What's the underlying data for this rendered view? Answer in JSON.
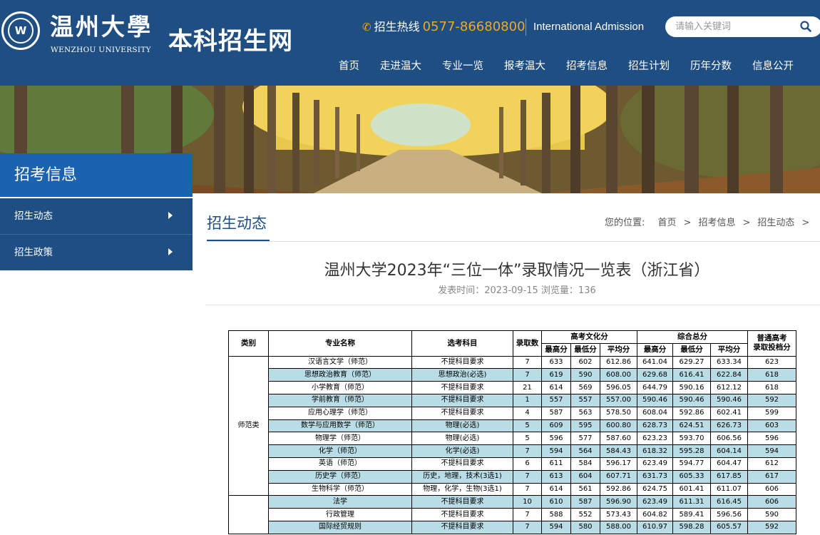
{
  "header": {
    "logo_mark": "W",
    "university_cn": "温州大學",
    "university_en": "WENZHOU UNIVERSITY",
    "site_title": "本科招生网",
    "hotline_label": "招生热线",
    "hotline_number": "0577-86680800",
    "intl_link": "International Admission",
    "search_placeholder": "请输入关键词",
    "nav": [
      "首页",
      "走进温大",
      "专业一览",
      "报考温大",
      "招考信息",
      "招生计划",
      "历年分数",
      "信息公开"
    ]
  },
  "sidebar": {
    "title": "招考信息",
    "items": [
      {
        "label": "招生动态"
      },
      {
        "label": "招生政策"
      }
    ]
  },
  "section": {
    "title": "招生动态",
    "breadcrumb_prefix": "您的位置:",
    "breadcrumb": [
      "首页",
      "招考信息",
      "招生动态"
    ],
    "sep": ">"
  },
  "article": {
    "title": "温州大学2023年“三位一体”录取情况一览表（浙江省）",
    "meta": "发表时间：2023-09-15   浏览量：136"
  },
  "table": {
    "headers": {
      "category": "类别",
      "major": "专业名称",
      "subject": "选考科目",
      "admitted": "录取数",
      "gaokao_group": "高考文化分",
      "composite_group": "综合总分",
      "max": "最高分",
      "min": "最低分",
      "avg": "平均分",
      "cutoff_line1": "普通高考",
      "cutoff_line2": "录取投档分"
    },
    "groups": [
      {
        "category": "师范类",
        "rows": [
          {
            "major": "汉语言文学（师范）",
            "subject": "不提科目要求",
            "count": "7",
            "g_max": "633",
            "g_min": "602",
            "g_avg": "612.86",
            "c_max": "641.04",
            "c_min": "629.27",
            "c_avg": "633.34",
            "cutoff": "623"
          },
          {
            "major": "思想政治教育（师范）",
            "subject": "思想政治(必选)",
            "count": "7",
            "g_max": "619",
            "g_min": "590",
            "g_avg": "608.00",
            "c_max": "629.68",
            "c_min": "616.41",
            "c_avg": "622.84",
            "cutoff": "618"
          },
          {
            "major": "小学教育（师范）",
            "subject": "不提科目要求",
            "count": "21",
            "g_max": "614",
            "g_min": "569",
            "g_avg": "596.05",
            "c_max": "644.79",
            "c_min": "590.16",
            "c_avg": "612.12",
            "cutoff": "618"
          },
          {
            "major": "学前教育（师范）",
            "subject": "不提科目要求",
            "count": "1",
            "g_max": "557",
            "g_min": "557",
            "g_avg": "557.00",
            "c_max": "590.46",
            "c_min": "590.46",
            "c_avg": "590.46",
            "cutoff": "592"
          },
          {
            "major": "应用心理学（师范）",
            "subject": "不提科目要求",
            "count": "4",
            "g_max": "587",
            "g_min": "563",
            "g_avg": "578.50",
            "c_max": "608.04",
            "c_min": "592.86",
            "c_avg": "602.41",
            "cutoff": "599"
          },
          {
            "major": "数学与应用数学（师范）",
            "subject": "物理(必选)",
            "count": "5",
            "g_max": "609",
            "g_min": "595",
            "g_avg": "600.80",
            "c_max": "628.73",
            "c_min": "624.51",
            "c_avg": "626.73",
            "cutoff": "603"
          },
          {
            "major": "物理学（师范）",
            "subject": "物理(必选)",
            "count": "5",
            "g_max": "596",
            "g_min": "577",
            "g_avg": "587.60",
            "c_max": "623.23",
            "c_min": "593.70",
            "c_avg": "606.56",
            "cutoff": "596"
          },
          {
            "major": "化学（师范）",
            "subject": "化学(必选)",
            "count": "7",
            "g_max": "594",
            "g_min": "564",
            "g_avg": "584.43",
            "c_max": "618.32",
            "c_min": "595.28",
            "c_avg": "604.14",
            "cutoff": "594"
          },
          {
            "major": "英语（师范）",
            "subject": "不提科目要求",
            "count": "6",
            "g_max": "611",
            "g_min": "584",
            "g_avg": "596.17",
            "c_max": "623.49",
            "c_min": "594.77",
            "c_avg": "604.47",
            "cutoff": "612"
          },
          {
            "major": "历史学（师范）",
            "subject": "历史，地理，技术(3选1)",
            "count": "7",
            "g_max": "613",
            "g_min": "604",
            "g_avg": "607.71",
            "c_max": "631.73",
            "c_min": "605.33",
            "c_avg": "617.85",
            "cutoff": "617"
          },
          {
            "major": "生物科学（师范）",
            "subject": "物理，化学，生物(3选1)",
            "count": "7",
            "g_max": "614",
            "g_min": "561",
            "g_avg": "592.86",
            "c_max": "624.75",
            "c_min": "601.41",
            "c_avg": "611.07",
            "cutoff": "606"
          }
        ]
      },
      {
        "category": "",
        "rows": [
          {
            "major": "法学",
            "subject": "不提科目要求",
            "count": "10",
            "g_max": "610",
            "g_min": "587",
            "g_avg": "596.90",
            "c_max": "623.49",
            "c_min": "611.31",
            "c_avg": "616.45",
            "cutoff": "606"
          },
          {
            "major": "行政管理",
            "subject": "不提科目要求",
            "count": "7",
            "g_max": "588",
            "g_min": "552",
            "g_avg": "573.43",
            "c_max": "604.82",
            "c_min": "589.41",
            "c_avg": "596.56",
            "cutoff": "590"
          },
          {
            "major": "国际经贸规则",
            "subject": "不提科目要求",
            "count": "7",
            "g_max": "594",
            "g_min": "580",
            "g_avg": "588.00",
            "c_max": "610.97",
            "c_min": "598.28",
            "c_avg": "605.57",
            "cutoff": "592"
          }
        ]
      }
    ]
  }
}
